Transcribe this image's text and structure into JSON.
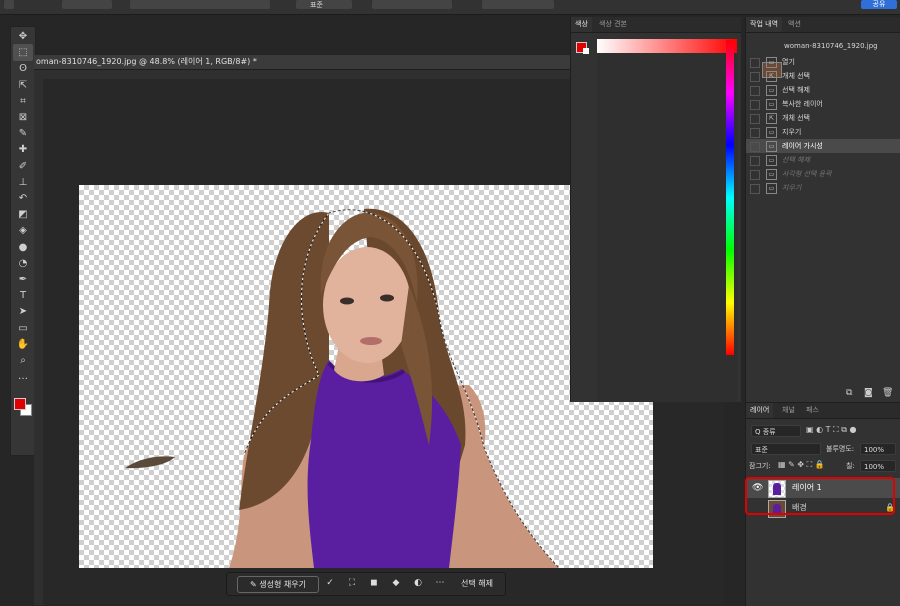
{
  "topbar": {
    "share_label": "공유",
    "mode_value": "표준"
  },
  "document": {
    "tab_title": "oman-8310746_1920.jpg @ 48.8% (레이어 1, RGB/8#) *"
  },
  "toolbar": {
    "tools": [
      {
        "name": "move-tool",
        "icon": "✥"
      },
      {
        "name": "marquee-tool",
        "icon": "⬚"
      },
      {
        "name": "lasso-tool",
        "icon": "ʘ"
      },
      {
        "name": "object-select-tool",
        "icon": "⇱"
      },
      {
        "name": "crop-tool",
        "icon": "⌗"
      },
      {
        "name": "frame-tool",
        "icon": "⊠"
      },
      {
        "name": "eyedropper-tool",
        "icon": "✎"
      },
      {
        "name": "healing-brush-tool",
        "icon": "✚"
      },
      {
        "name": "brush-tool",
        "icon": "✐"
      },
      {
        "name": "clone-stamp-tool",
        "icon": "⊥"
      },
      {
        "name": "history-brush-tool",
        "icon": "↶"
      },
      {
        "name": "eraser-tool",
        "icon": "◩"
      },
      {
        "name": "paint-bucket-tool",
        "icon": "◈"
      },
      {
        "name": "blur-tool",
        "icon": "●"
      },
      {
        "name": "dodge-tool",
        "icon": "◔"
      },
      {
        "name": "pen-tool",
        "icon": "✒"
      },
      {
        "name": "type-tool",
        "icon": "T"
      },
      {
        "name": "path-select-tool",
        "icon": "➤"
      },
      {
        "name": "rectangle-tool",
        "icon": "▭"
      },
      {
        "name": "hand-tool",
        "icon": "✋"
      },
      {
        "name": "zoom-tool",
        "icon": "⌕"
      },
      {
        "name": "more-tools",
        "icon": "…"
      }
    ],
    "foreground_color": "#e00000",
    "background_color": "#ffffff"
  },
  "color_panel": {
    "tabs": [
      "색상",
      "색상 견본"
    ]
  },
  "history_panel": {
    "tabs": [
      "작업 내역",
      "액션"
    ],
    "snapshot_label": "woman-8310746_1920.jpg",
    "steps": [
      {
        "label": "열기",
        "state": "normal"
      },
      {
        "label": "개체 선택",
        "state": "normal"
      },
      {
        "label": "선택 해제",
        "state": "normal"
      },
      {
        "label": "복사한 레이어",
        "state": "normal"
      },
      {
        "label": "개체 선택",
        "state": "normal"
      },
      {
        "label": "지우기",
        "state": "normal"
      },
      {
        "label": "레이어 가시성",
        "state": "selected"
      },
      {
        "label": "선택 해제",
        "state": "dimmed"
      },
      {
        "label": "사각형 선택 윤곽",
        "state": "dimmed"
      },
      {
        "label": "지우기",
        "state": "dimmed"
      }
    ]
  },
  "layers_panel": {
    "tabs": [
      "레이어",
      "채널",
      "패스"
    ],
    "filter_label": "Q 종류",
    "blend_mode": "표준",
    "opacity_label": "불투명도:",
    "opacity_value": "100%",
    "lock_label": "잠그기:",
    "fill_label": "칠:",
    "fill_value": "100%",
    "layers": [
      {
        "name": "레이어 1",
        "visible": true,
        "selected": true
      },
      {
        "name": "배경",
        "visible": false,
        "selected": false,
        "locked": true
      }
    ]
  },
  "context_bar": {
    "generative_fill_label": "생성형 채우기",
    "deselect_label": "선택 해제"
  },
  "colors": {
    "accent_red": "#e00000",
    "share_blue": "#2e6fd8",
    "dress_purple": "#5a1fa0"
  }
}
